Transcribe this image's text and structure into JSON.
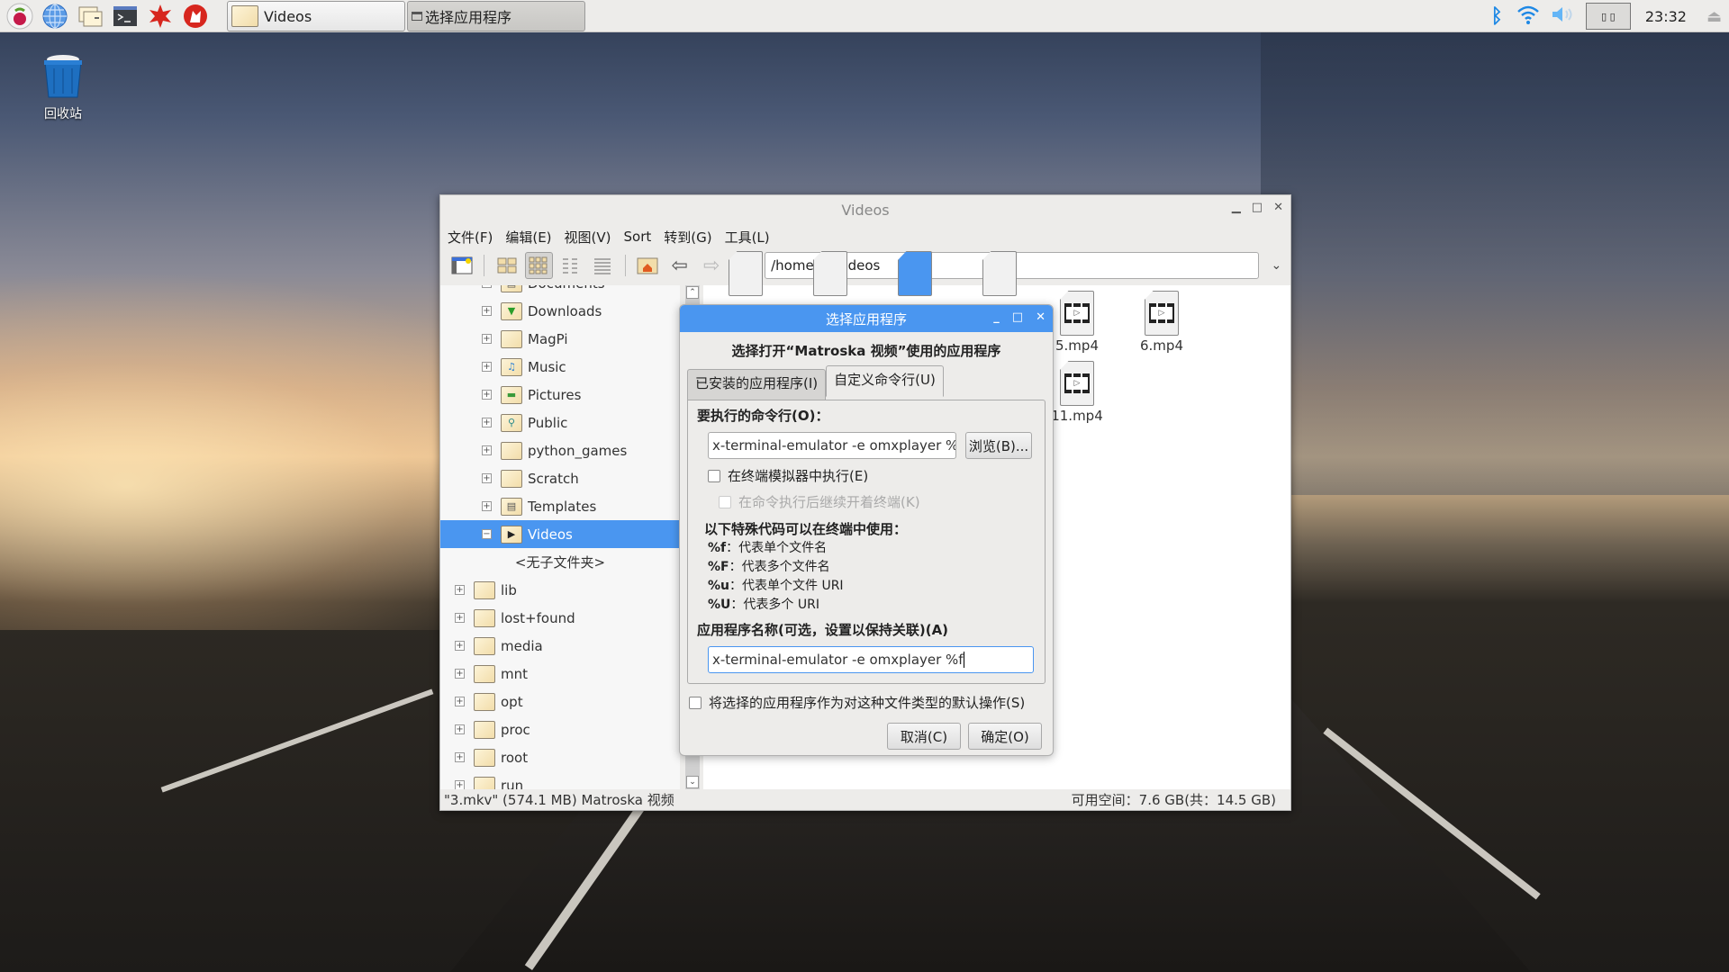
{
  "taskbar": {
    "launchers": [
      "raspberry-menu",
      "web-browser",
      "file-manager",
      "terminal",
      "mathematica",
      "wolfram"
    ],
    "tasks": [
      {
        "label": "Videos",
        "icon": "folder-icon",
        "active": false
      },
      {
        "label": "选择应用程序",
        "icon": "window-icon",
        "active": true
      }
    ],
    "tray": {
      "clock": "23:32",
      "cpu_label": "▯ ▯"
    }
  },
  "desktop": {
    "trash_label": "回收站"
  },
  "window": {
    "title": "Videos",
    "menu": [
      "文件(F)",
      "编辑(E)",
      "视图(V)",
      "Sort",
      "转到(G)",
      "工具(L)"
    ],
    "path": "/home/pi/Videos",
    "tree": [
      {
        "label": "Documents",
        "icon": "doc",
        "level": 1
      },
      {
        "label": "Downloads",
        "icon": "download",
        "level": 1
      },
      {
        "label": "MagPi",
        "icon": "",
        "level": 1
      },
      {
        "label": "Music",
        "icon": "music",
        "level": 1
      },
      {
        "label": "Pictures",
        "icon": "picture",
        "level": 1
      },
      {
        "label": "Public",
        "icon": "public",
        "level": 1
      },
      {
        "label": "python_games",
        "icon": "",
        "level": 1
      },
      {
        "label": "Scratch",
        "icon": "",
        "level": 1
      },
      {
        "label": "Templates",
        "icon": "template",
        "level": 1
      },
      {
        "label": "Videos",
        "icon": "video",
        "level": 1,
        "selected": true,
        "expanded": true
      },
      {
        "label": "<无子文件夹>",
        "level": 2,
        "placeholder": true
      },
      {
        "label": "lib",
        "level": 0
      },
      {
        "label": "lost+found",
        "level": 0
      },
      {
        "label": "media",
        "level": 0
      },
      {
        "label": "mnt",
        "level": 0
      },
      {
        "label": "opt",
        "level": 0
      },
      {
        "label": "proc",
        "level": 0
      },
      {
        "label": "root",
        "level": 0
      },
      {
        "label": "run",
        "level": 0
      }
    ],
    "files": [
      {
        "label": "5.mp4"
      },
      {
        "label": "6.mp4"
      },
      {
        "label": "11.mp4"
      }
    ],
    "status_left": "\"3.mkv\" (574.1 MB) Matroska 视频",
    "status_right": "可用空间：7.6 GB(共：14.5 GB)"
  },
  "dialog": {
    "title": "选择应用程序",
    "heading": "选择打开“Matroska 视频”使用的应用程序",
    "tabs": [
      {
        "label": "已安装的应用程序(I)",
        "active": false
      },
      {
        "label": "自定义命令行(U)",
        "active": true
      }
    ],
    "command_label": "要执行的命令行(O)：",
    "command_value": "x-terminal-emulator -e omxplayer %f",
    "browse_label": "浏览(B)...",
    "run_in_terminal": {
      "label": "在终端模拟器中执行(E)",
      "checked": false
    },
    "keep_open": {
      "label": "在命令执行后继续开着终端(K)",
      "checked": false,
      "disabled": true
    },
    "codes_heading": "以下特殊代码可以在终端中使用：",
    "codes": [
      {
        "code": "%f",
        "desc": "：代表单个文件名"
      },
      {
        "code": "%F",
        "desc": "：代表多个文件名"
      },
      {
        "code": "%u",
        "desc": "：代表单个文件 URI"
      },
      {
        "code": "%U",
        "desc": "：代表多个 URI"
      }
    ],
    "app_name_label": "应用程序名称(可选，设置以保持关联)(A)",
    "app_name_value": "x-terminal-emulator -e omxplayer %f",
    "default_action": {
      "label": "将选择的应用程序作为对这种文件类型的默认操作(S)",
      "checked": false
    },
    "cancel_label": "取消(C)",
    "ok_label": "确定(O)"
  }
}
